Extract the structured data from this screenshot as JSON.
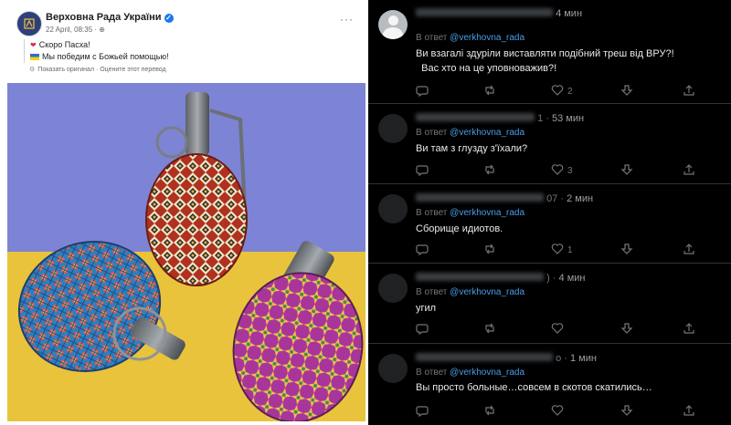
{
  "facebook_post": {
    "page_name": "Верховна Рада України",
    "timestamp": "22 April, 08:35 · ",
    "lines": [
      {
        "emoji": "❤",
        "text": "Скоро Пасха!"
      },
      {
        "emoji": "flag",
        "text": "Мы победим с Божьей помощью!"
      }
    ],
    "translation_link": "Показать оригинал · Оцените этот перевод",
    "more_label": "···"
  },
  "twitter_replies": [
    {
      "name_suffix": "",
      "time": "4 мин",
      "in_reply_prefix": "В ответ ",
      "handle": "@verkhovna_rada",
      "body_lines": [
        "Ви взагалі здуріли виставляти подібний треш від ВРУ?!",
        "  Вас хто на це уповноважив?!"
      ],
      "like_count": "2",
      "default_avatar": true
    },
    {
      "name_suffix": "1 ·",
      "time": "53 мин",
      "in_reply_prefix": "В ответ ",
      "handle": "@verkhovna_rada",
      "body_lines": [
        "Ви там з глузду з'їхали?"
      ],
      "like_count": "3",
      "default_avatar": false
    },
    {
      "name_suffix": "07 ·",
      "time": "2 мин",
      "in_reply_prefix": "В ответ ",
      "handle": "@verkhovna_rada",
      "body_lines": [
        "Сборище идиотов."
      ],
      "like_count": "1",
      "default_avatar": false
    },
    {
      "name_suffix": ") ·",
      "time": "4 мин",
      "in_reply_prefix": "В ответ ",
      "handle": "@verkhovna_rada",
      "body_lines": [
        "угил"
      ],
      "like_count": "",
      "default_avatar": false
    },
    {
      "name_suffix": "о ·",
      "time": "1 мин",
      "in_reply_prefix": "В ответ ",
      "handle": "@verkhovna_rada",
      "body_lines": [
        "Вы просто больные…совсем в скотов скатились…"
      ],
      "like_count": "",
      "default_avatar": false
    }
  ],
  "icons": [
    "reply-icon",
    "retweet-icon",
    "like-icon",
    "downvote-icon",
    "share-icon"
  ],
  "colors": {
    "twitter_bg": "#000000",
    "handle": "#4a9de8",
    "fb_text": "#1c1e21",
    "flag_blue": "#2b6ad8",
    "flag_yellow": "#f5d20a"
  }
}
